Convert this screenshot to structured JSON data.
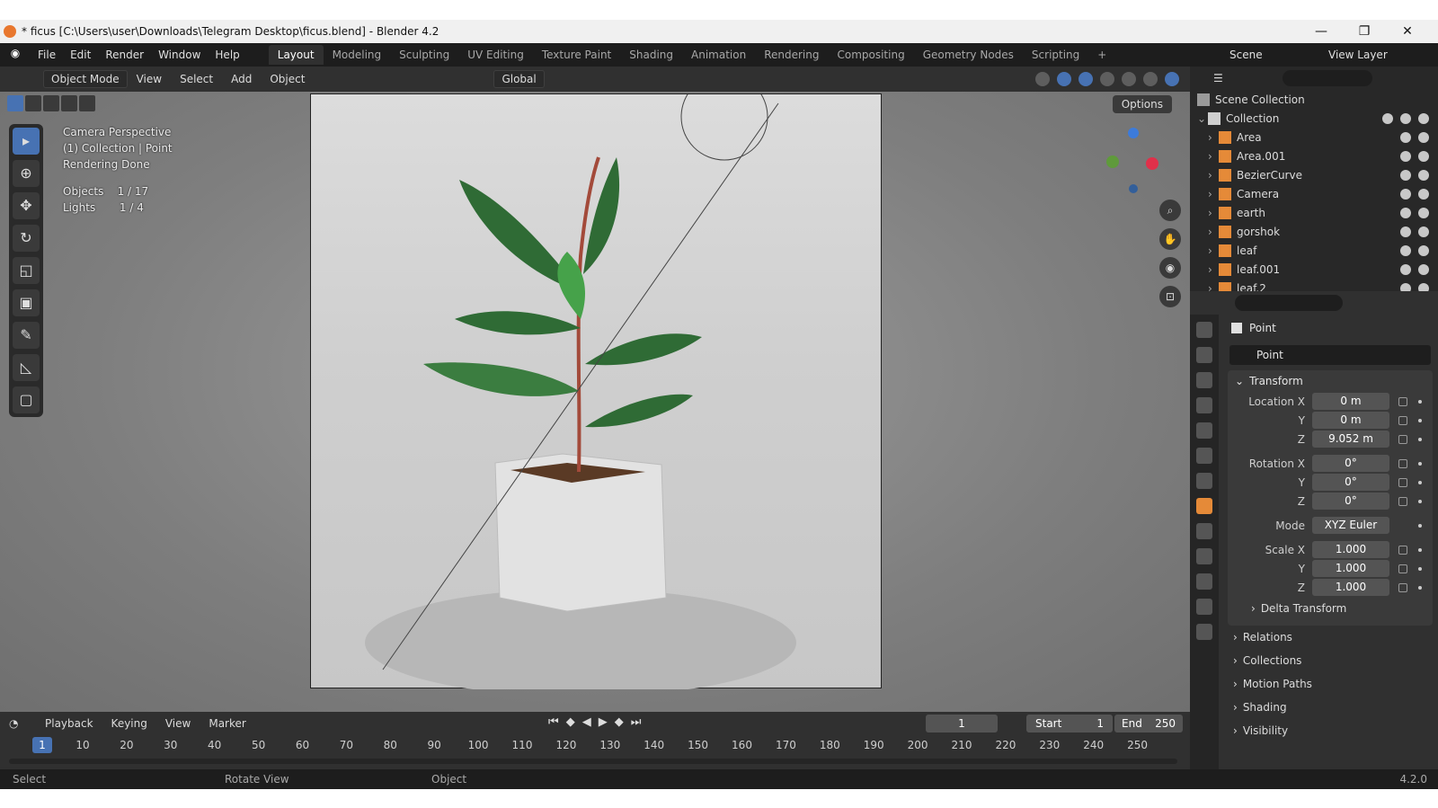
{
  "window": {
    "title": "* ficus [C:\\Users\\user\\Downloads\\Telegram Desktop\\ficus.blend] - Blender 4.2",
    "controls": [
      "—",
      "❐",
      "✕"
    ]
  },
  "menubar": {
    "menus": [
      "File",
      "Edit",
      "Render",
      "Window",
      "Help"
    ],
    "workspaces": [
      "Layout",
      "Modeling",
      "Sculpting",
      "UV Editing",
      "Texture Paint",
      "Shading",
      "Animation",
      "Rendering",
      "Compositing",
      "Geometry Nodes",
      "Scripting"
    ],
    "add_tab": "+",
    "scene": "Scene",
    "view_layer": "View Layer"
  },
  "viewport_header": {
    "mode": "Object Mode",
    "menus": [
      "View",
      "Select",
      "Add",
      "Object"
    ],
    "transform_orientation": "Global"
  },
  "viewport": {
    "info": [
      "Camera Perspective",
      "(1) Collection | Point",
      "Rendering Done"
    ],
    "stats": [
      {
        "label": "Objects",
        "value": "1 / 17"
      },
      {
        "label": "Lights",
        "value": "1 / 4"
      }
    ],
    "options_label": "Options"
  },
  "outliner": {
    "root": "Scene Collection",
    "collection": "Collection",
    "items": [
      "Area",
      "Area.001",
      "BezierCurve",
      "Camera",
      "earth",
      "gorshok",
      "leaf",
      "leaf.001",
      "leaf.2"
    ]
  },
  "properties": {
    "object_name": "Point",
    "data_name": "Point",
    "transform_title": "Transform",
    "location": {
      "label_x": "Location X",
      "x": "0 m",
      "y": "0 m",
      "z": "9.052 m"
    },
    "rotation": {
      "label_x": "Rotation X",
      "x": "0°",
      "y": "0°",
      "z": "0°"
    },
    "mode": {
      "label": "Mode",
      "value": "XYZ Euler"
    },
    "scale": {
      "label_x": "Scale X",
      "x": "1.000",
      "y": "1.000",
      "z": "1.000"
    },
    "axis_y": "Y",
    "axis_z": "Z",
    "delta_transform": "Delta Transform",
    "sections": [
      "Relations",
      "Collections",
      "Motion Paths",
      "Shading",
      "Visibility"
    ]
  },
  "timeline": {
    "menus": [
      "Playback",
      "Keying",
      "View",
      "Marker"
    ],
    "current_frame": "1",
    "start_label": "Start",
    "start": "1",
    "end_label": "End",
    "end": "250",
    "ticks": [
      "10",
      "20",
      "30",
      "40",
      "50",
      "60",
      "70",
      "80",
      "90",
      "100",
      "110",
      "120",
      "130",
      "140",
      "150",
      "160",
      "170",
      "180",
      "190",
      "200",
      "210",
      "220",
      "230",
      "240",
      "250"
    ]
  },
  "statusbar": {
    "select": "Select",
    "rotate": "Rotate View",
    "object": "Object",
    "version": "4.2.0"
  }
}
